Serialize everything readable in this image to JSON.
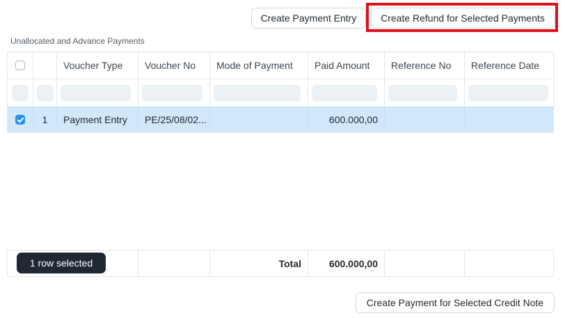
{
  "toolbar": {
    "create_payment_entry": "Create Payment Entry",
    "create_refund": "Create Refund for Selected Payments"
  },
  "section": {
    "title": "Unallocated and Advance Payments"
  },
  "grid": {
    "columns": [
      "Voucher Type",
      "Voucher No",
      "Mode of Payment",
      "Paid Amount",
      "Reference No",
      "Reference Date"
    ],
    "rows": [
      {
        "index": "1",
        "voucher_type": "Payment Entry",
        "voucher_no": "PE/25/08/02...",
        "mode_of_payment": "",
        "paid_amount": "600.000,00",
        "reference_no": "",
        "reference_date": "",
        "selected": true
      }
    ]
  },
  "footer": {
    "selection_label": "1 row selected",
    "total_label": "Total",
    "total_amount": "600.000,00"
  },
  "bottom": {
    "create_payment_credit_note": "Create Payment for Selected Credit Note"
  },
  "colors": {
    "accent": "#2490ef",
    "highlight": "#e0101b",
    "selected_row": "#d1e8fb"
  }
}
